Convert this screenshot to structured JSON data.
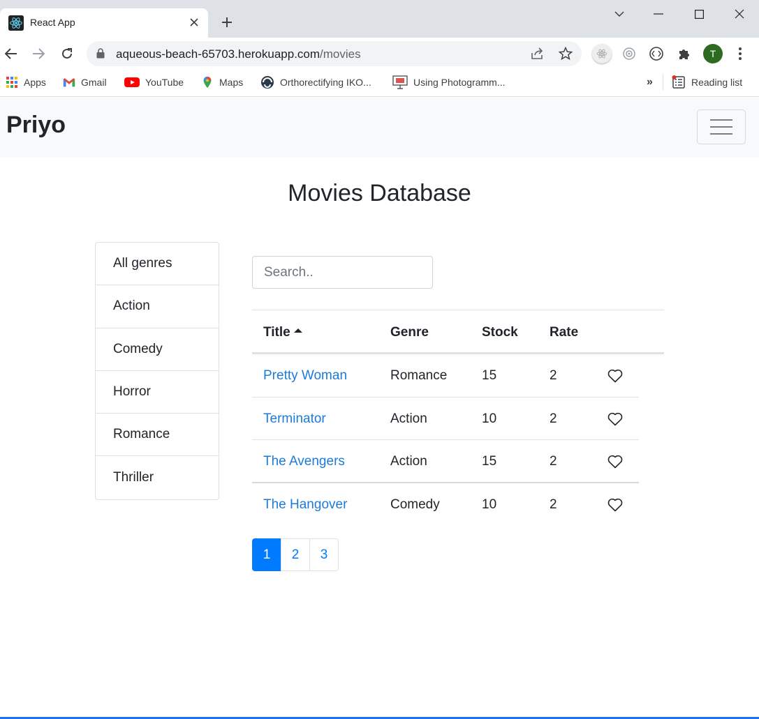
{
  "browser": {
    "tab_title": "React App",
    "url_host": "aqueous-beach-65703.herokuapp.com",
    "url_path": "/movies",
    "profile_initial": "T",
    "bookmarks": [
      {
        "label": "Apps",
        "icon": "apps-grid-icon"
      },
      {
        "label": "Gmail",
        "icon": "gmail-icon"
      },
      {
        "label": "YouTube",
        "icon": "youtube-icon"
      },
      {
        "label": "Maps",
        "icon": "maps-icon"
      },
      {
        "label": "Orthorectifying IKO...",
        "icon": "site-icon"
      },
      {
        "label": "Using Photogramm...",
        "icon": "presentation-icon"
      }
    ],
    "bookmarks_overflow": "»",
    "reading_list": "Reading list"
  },
  "navbar": {
    "brand": "Priyo"
  },
  "page": {
    "title": "Movies Database"
  },
  "genres": [
    "All genres",
    "Action",
    "Comedy",
    "Horror",
    "Romance",
    "Thriller"
  ],
  "search": {
    "placeholder": "Search.."
  },
  "table": {
    "columns": [
      "Title",
      "Genre",
      "Stock",
      "Rate"
    ],
    "sorted_column": "Title",
    "sort_direction": "asc",
    "rows": [
      {
        "title": "Pretty Woman",
        "genre": "Romance",
        "stock": "15",
        "rate": "2"
      },
      {
        "title": "Terminator",
        "genre": "Action",
        "stock": "10",
        "rate": "2"
      },
      {
        "title": "The Avengers",
        "genre": "Action",
        "stock": "15",
        "rate": "2"
      },
      {
        "title": "The Hangover",
        "genre": "Comedy",
        "stock": "10",
        "rate": "2"
      }
    ]
  },
  "pagination": {
    "pages": [
      "1",
      "2",
      "3"
    ],
    "active": "1"
  },
  "colors": {
    "primary": "#007bff",
    "navbar_bg": "#f8f9fa",
    "link": "#1c7bd8"
  }
}
